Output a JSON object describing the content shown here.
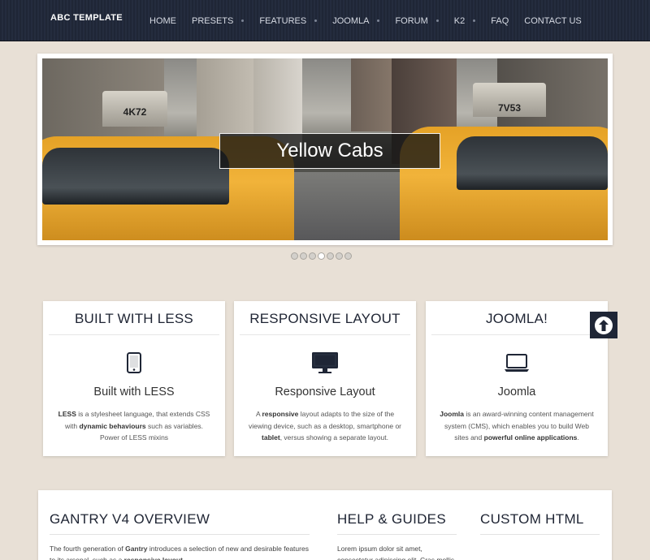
{
  "header": {
    "logo": "ABC TEMPLATE",
    "nav": [
      {
        "label": "HOME",
        "has_sub": false
      },
      {
        "label": "PRESETS",
        "has_sub": true
      },
      {
        "label": "FEATURES",
        "has_sub": true
      },
      {
        "label": "JOOMLA",
        "has_sub": true
      },
      {
        "label": "FORUM",
        "has_sub": true
      },
      {
        "label": "K2",
        "has_sub": true
      },
      {
        "label": "FAQ",
        "has_sub": false
      },
      {
        "label": "CONTACT US",
        "has_sub": false
      }
    ]
  },
  "slider": {
    "caption": "Yellow Cabs",
    "cab_left_sign": "4K72",
    "cab_right_sign": "7V53",
    "dot_count": 7,
    "active_dot": 4
  },
  "features": [
    {
      "title": "BUILT WITH LESS",
      "icon": "tablet-icon",
      "subtitle": "Built with LESS",
      "desc_parts": [
        {
          "b": true,
          "t": "LESS"
        },
        {
          "b": false,
          "t": " is a stylesheet language, that extends CSS with "
        },
        {
          "b": true,
          "t": "dynamic behaviours"
        },
        {
          "b": false,
          "t": " such as variables. Power of LESS mixins"
        }
      ]
    },
    {
      "title": "RESPONSIVE LAYOUT",
      "icon": "monitor-icon",
      "subtitle": "Responsive Layout",
      "desc_parts": [
        {
          "b": false,
          "t": "A "
        },
        {
          "b": true,
          "t": "responsive"
        },
        {
          "b": false,
          "t": " layout adapts to the size of the viewing device, such as a desktop, smartphone or "
        },
        {
          "b": true,
          "t": "tablet"
        },
        {
          "b": false,
          "t": ", versus showing a separate layout."
        }
      ]
    },
    {
      "title": "JOOMLA!",
      "icon": "laptop-icon",
      "subtitle": "Joomla",
      "desc_parts": [
        {
          "b": true,
          "t": "Joomla"
        },
        {
          "b": false,
          "t": " is an award-winning content management system (CMS), which enables you to build Web sites and "
        },
        {
          "b": true,
          "t": "powerful online applications"
        },
        {
          "b": false,
          "t": "."
        }
      ]
    }
  ],
  "bottom": {
    "gantry_title": "GANTRY V4 OVERVIEW",
    "gantry_parts": [
      {
        "b": false,
        "t": "The fourth generation of "
      },
      {
        "b": true,
        "t": "Gantry"
      },
      {
        "b": false,
        "t": " introduces a selection of new and desirable features to its arsenal, such as a "
      },
      {
        "b": true,
        "t": "responsive layout"
      },
      {
        "b": false,
        "t": "."
      }
    ],
    "help_title": "HELP & GUIDES",
    "help_text": "Lorem ipsum dolor sit amet, consectetur adipiscing elit. Cras mollis",
    "custom_title": "CUSTOM HTML"
  },
  "colors": {
    "header_bg": "#222a3b",
    "page_bg": "#e8e0d6",
    "accent_dark": "#1e2433"
  }
}
